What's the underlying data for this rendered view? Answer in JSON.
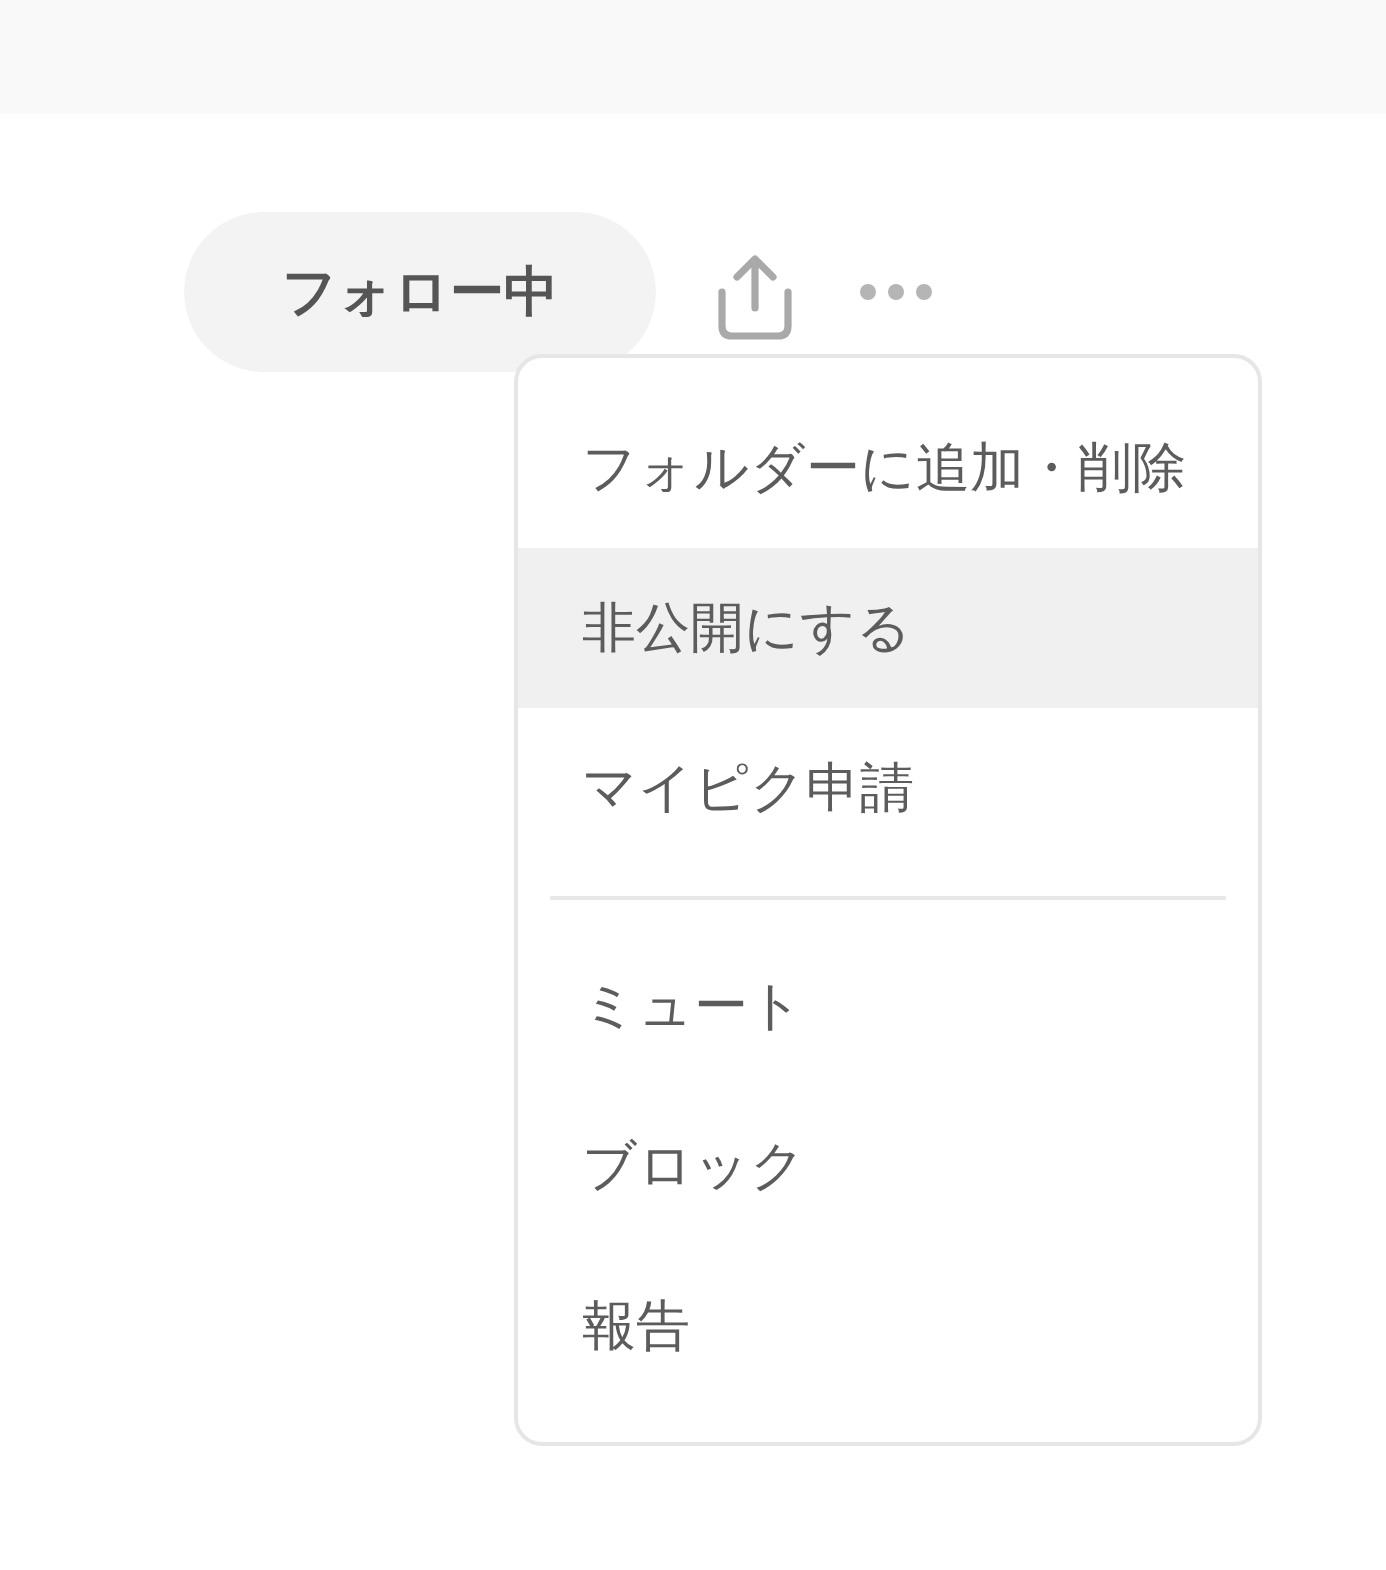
{
  "follow_button": {
    "label": "フォロー中"
  },
  "menu": {
    "sections": [
      {
        "items": [
          {
            "label": "フォルダーに追加・削除",
            "selected": false
          },
          {
            "label": "非公開にする",
            "selected": true
          },
          {
            "label": "マイピク申請",
            "selected": false
          }
        ]
      },
      {
        "items": [
          {
            "label": "ミュート",
            "selected": false
          },
          {
            "label": "ブロック",
            "selected": false
          },
          {
            "label": "報告",
            "selected": false
          }
        ]
      }
    ]
  }
}
